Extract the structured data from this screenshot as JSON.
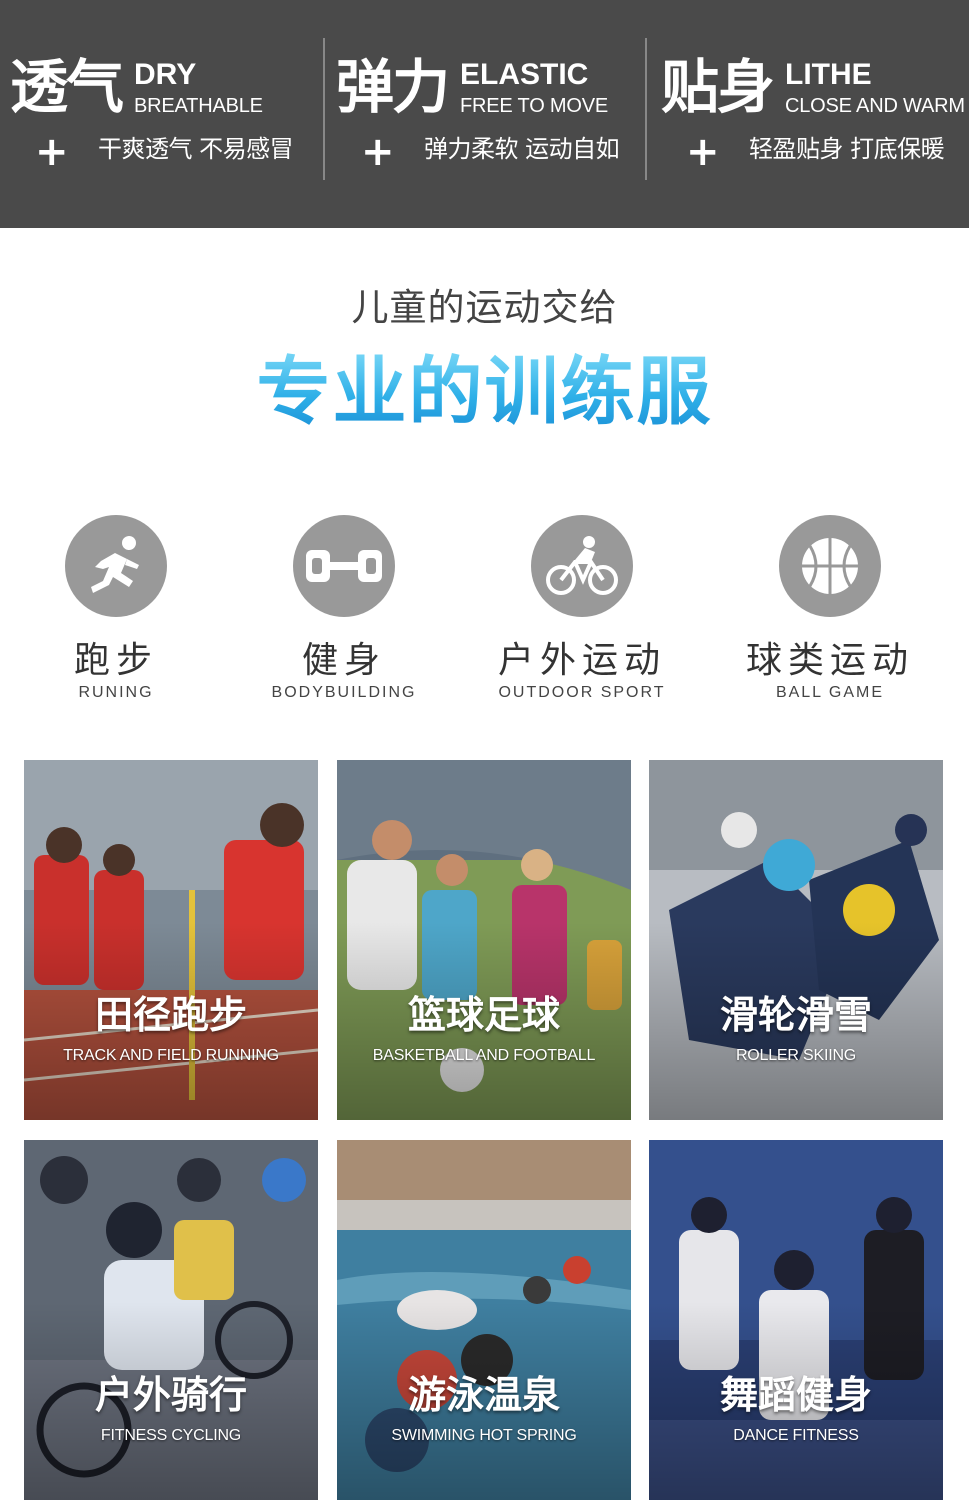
{
  "features": [
    {
      "zh": "透气",
      "en_title": "DRY",
      "en_sub": "BREATHABLE",
      "plus": "+",
      "desc": "干爽透气 不易感冒"
    },
    {
      "zh": "弹力",
      "en_title": "ELASTIC",
      "en_sub": "FREE TO MOVE",
      "plus": "+",
      "desc": "弹力柔软 运动自如"
    },
    {
      "zh": "贴身",
      "en_title": "LITHE",
      "en_sub": "CLOSE AND WARM",
      "plus": "+",
      "desc": "轻盈贴身 打底保暖"
    }
  ],
  "headline": {
    "subtitle": "儿童的运动交给",
    "title": "专业的训练服"
  },
  "sports": [
    {
      "zh": "跑步",
      "en": "RUNING",
      "icon": "running-icon"
    },
    {
      "zh": "健身",
      "en": "BODYBUILDING",
      "icon": "dumbbell-icon"
    },
    {
      "zh": "户外运动",
      "en": "OUTDOOR SPORT",
      "icon": "cycling-icon"
    },
    {
      "zh": "球类运动",
      "en": "BALL GAME",
      "icon": "basketball-icon"
    }
  ],
  "tiles": [
    {
      "zh": "田径跑步",
      "en": "TRACK AND FIELD RUNNING"
    },
    {
      "zh": "篮球足球",
      "en": "BASKETBALL AND FOOTBALL"
    },
    {
      "zh": "滑轮滑雪",
      "en": "ROLLER SKIING"
    },
    {
      "zh": "户外骑行",
      "en": "FITNESS CYCLING"
    },
    {
      "zh": "游泳温泉",
      "en": "SWIMMING HOT SPRING"
    },
    {
      "zh": "舞蹈健身",
      "en": "DANCE FITNESS"
    }
  ],
  "colors": {
    "topbar": "#4a4a4a",
    "headline_gradient_start": "#7ad8f7",
    "headline_gradient_end": "#1a8fd6",
    "icon_circle": "#999999"
  }
}
